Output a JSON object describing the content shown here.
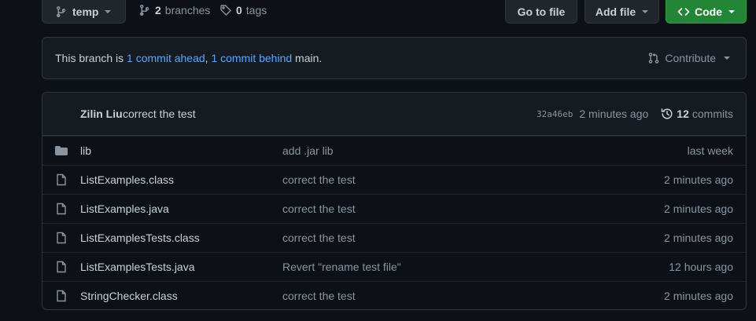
{
  "toolbar": {
    "branch_label": "temp",
    "branches_count": "2",
    "branches_label": "branches",
    "tags_count": "0",
    "tags_label": "tags",
    "goto_label": "Go to file",
    "add_file_label": "Add file",
    "code_label": "Code"
  },
  "status": {
    "prefix": "This branch is ",
    "ahead": "1 commit ahead",
    "sep": ", ",
    "behind": "1 commit behind",
    "suffix": " main.",
    "contribute_label": "Contribute"
  },
  "latest_commit": {
    "author": "Zilin Liu",
    "message": "correct the test",
    "sha": "32a46eb",
    "time": "2 minutes ago",
    "commits_count": "12",
    "commits_label": "commits"
  },
  "files": [
    {
      "name": "lib",
      "type": "folder",
      "message": "add .jar lib",
      "date": "last week"
    },
    {
      "name": "ListExamples.class",
      "type": "file",
      "message": "correct the test",
      "date": "2 minutes ago"
    },
    {
      "name": "ListExamples.java",
      "type": "file",
      "message": "correct the test",
      "date": "2 minutes ago"
    },
    {
      "name": "ListExamplesTests.class",
      "type": "file",
      "message": "correct the test",
      "date": "2 minutes ago"
    },
    {
      "name": "ListExamplesTests.java",
      "type": "file",
      "message": "Revert \"rename test file\"",
      "date": "12 hours ago"
    },
    {
      "name": "StringChecker.class",
      "type": "file",
      "message": "correct the test",
      "date": "2 minutes ago"
    }
  ],
  "colors": {
    "background": "#0d1117",
    "link": "#58a6ff",
    "code_button": "#238636"
  }
}
